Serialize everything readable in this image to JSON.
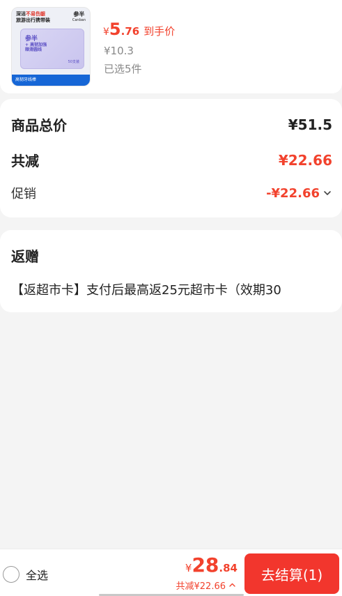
{
  "product": {
    "thumb": {
      "line1_prefix": "深洁",
      "line1_highlight": "不易伤龈",
      "line2": "旅游出行携带装",
      "brand": "参半",
      "brand_sub": "Canban",
      "box_title": "参半",
      "box_line1": "+ 高韧加强",
      "box_line2": "顺滑圆线",
      "box_count": "50支装",
      "footer_label": "高韧牙线棒"
    },
    "price_symbol": "¥",
    "price_int": "5",
    "price_dec": ".76",
    "price_tag": "到手价",
    "original_price": "¥10.3",
    "selected_count": "已选5件"
  },
  "totals": {
    "goods_total_label": "商品总价",
    "goods_total_value": "¥51.5",
    "reduction_label": "共减",
    "reduction_value": "¥22.66",
    "promo_label": "促销",
    "promo_value": "-¥22.66"
  },
  "gift": {
    "title": "返赠",
    "description": "【返超市卡】支付后最高返25元超市卡（效期30"
  },
  "bottom_bar": {
    "select_all_label": "全选",
    "pay_symbol": "¥",
    "pay_int": "28",
    "pay_dec": ".84",
    "pay_reduction": "共减¥22.66",
    "checkout_label": "去结算(1)"
  },
  "icons": {
    "promo_expand": "chevron-down-icon",
    "reduction_detail": "chevron-up-icon",
    "select_all": "radio-unchecked-icon"
  },
  "colors": {
    "accent_red": "#f2422d",
    "checkout_red": "#f2362d",
    "card_bg": "#ffffff",
    "page_bg": "#f4f4f4"
  }
}
